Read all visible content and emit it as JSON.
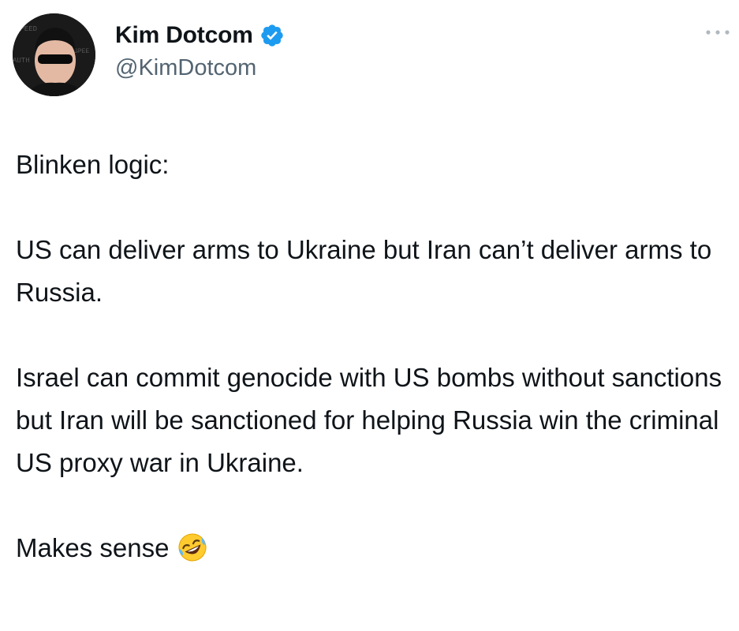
{
  "author": {
    "display_name": "Kim Dotcom",
    "handle": "@KimDotcom",
    "verified": true,
    "avatar_icon": "avatar-photo"
  },
  "tweet": {
    "paragraphs": [
      "Blinken logic:",
      "US can deliver arms to Ukraine but Iran can’t deliver arms to Russia.",
      "Israel can commit genocide with US bombs without sanctions but Iran will be sanctioned for helping Russia win the criminal US proxy war in Ukraine.",
      "Makes sense"
    ],
    "trailing_emoji": "rolling-on-floor-laughing-emoji"
  },
  "icons": {
    "verified": "verified-badge-icon",
    "more": "more-options-icon"
  },
  "colors": {
    "text_primary": "#0f1419",
    "text_secondary": "#536471",
    "verified_blue": "#1d9bf0",
    "background": "#ffffff"
  }
}
